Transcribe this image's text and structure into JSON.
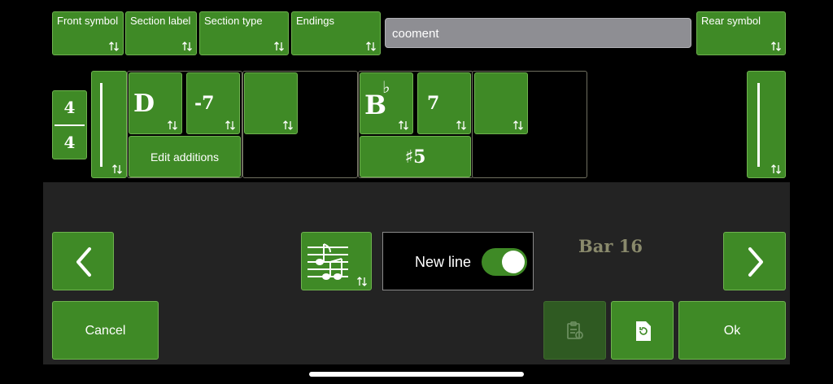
{
  "top_bar": {
    "front_symbol": "Front symbol",
    "section_label": "Section label",
    "section_type": "Section type",
    "endings": "Endings",
    "comment_value": "cooment",
    "rear_symbol": "Rear symbol"
  },
  "time_signature": {
    "top": "4",
    "bottom": "4"
  },
  "measures": [
    {
      "root": "D",
      "quality": "-7",
      "additions_label": "Edit additions"
    },
    {
      "root": "B",
      "accidental": "♭",
      "quality": "7",
      "addition": "♯5"
    }
  ],
  "controls": {
    "new_line_label": "New line",
    "new_line_on": true,
    "bar_label": "Bar 16",
    "cancel_label": "Cancel",
    "ok_label": "Ok"
  },
  "icons": [
    "swap-arrows-icon",
    "chevron-left-icon",
    "chevron-right-icon",
    "score-layout-icon",
    "paste-icon",
    "revert-icon"
  ],
  "colors": {
    "accent_green": "#3f8a26",
    "panel": "#232323",
    "comment_bg": "#8e8e93",
    "bar_label": "#8a8a6c"
  }
}
